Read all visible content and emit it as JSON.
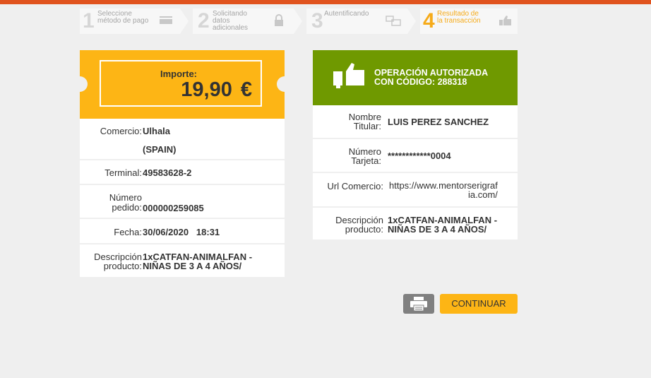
{
  "steps": [
    {
      "num": "1",
      "label_line1": "Seleccione",
      "label_line2": "método de pago",
      "icon": "card-icon"
    },
    {
      "num": "2",
      "label_line1": "Solicitando",
      "label_line2": "datos",
      "label_line3": "adicionales",
      "icon": "lock-icon"
    },
    {
      "num": "3",
      "label_line1": "Autentificando",
      "icon": "devices-icon"
    },
    {
      "num": "4",
      "label_line1": "Resultado de",
      "label_line2": "la transacción",
      "icon": "thumbs-up-icon"
    }
  ],
  "amount": {
    "label": "Importe:",
    "value": "19,90",
    "currency": "€"
  },
  "merchant": {
    "comercio_label": "Comercio:",
    "comercio_value": "Ulhala",
    "comercio_country": "(SPAIN)",
    "terminal_label": "Terminal:",
    "terminal_value": "49583628-2",
    "pedido_label_1": "Número",
    "pedido_label_2": "pedido:",
    "pedido_value": "000000259085",
    "fecha_label": "Fecha:",
    "fecha_value": "30/06/2020   18:31",
    "desc_label_1": "Descripción",
    "desc_label_2": "producto:",
    "desc_value_1": "1xCATFAN-ANIMALFAN -",
    "desc_value_2": "NIÑAS DE 3 A 4 AÑOS/"
  },
  "auth": {
    "line1": "OPERACIÓN AUTORIZADA",
    "line2": "CON CÓDIGO:  288318",
    "titular_label_1": "Nombre",
    "titular_label_2": "Titular:",
    "titular_value": "LUIS PEREZ SANCHEZ",
    "tarjeta_label_1": "Número",
    "tarjeta_label_2": "Tarjeta:",
    "tarjeta_value": "************0004",
    "url_label": "Url Comercio:",
    "url_value_1": "https://www.mentorserigraf",
    "url_value_2": "ia.com/",
    "desc_label_1": "Descripción",
    "desc_label_2": "producto:",
    "desc_value_1": "1xCATFAN-ANIMALFAN -",
    "desc_value_2": "NIÑAS DE 3 A 4 AÑOS/"
  },
  "buttons": {
    "print_icon": "printer-icon",
    "continue_label": "CONTINUAR"
  },
  "colors": {
    "accent": "#fdb515",
    "success": "#6f9900",
    "top_bar": "#e0531e"
  }
}
